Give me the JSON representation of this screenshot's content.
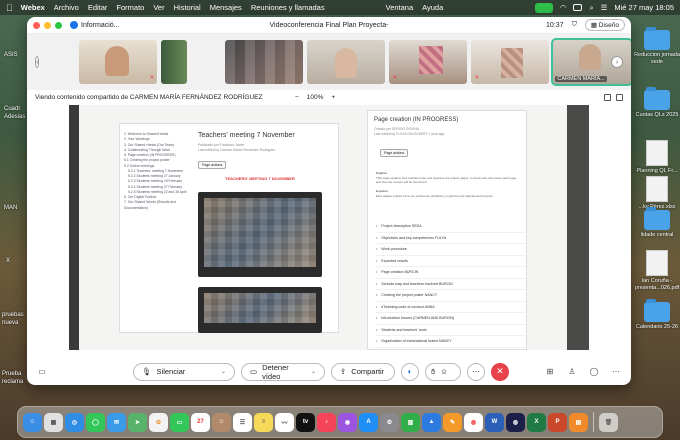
{
  "menubar": {
    "app": "Webex",
    "items": [
      "Archivo",
      "Editar",
      "Formato",
      "Ver",
      "Historial",
      "Mensajes",
      "Reuniones y llamadas"
    ],
    "extra": [
      "Ventana",
      "Ayuda"
    ],
    "datetime": "Mié 27 may 18:05"
  },
  "desktop": {
    "left_labels": [
      "ASIS",
      "Cuadr",
      "Adesias",
      "MAN",
      "X",
      "pruebas",
      "nueva",
      "Prueba",
      "reclama"
    ],
    "right_icons": [
      {
        "label": "Reduccion jornada sede",
        "kind": "folder"
      },
      {
        "label": "Cuotas QLs 2025",
        "kind": "folder"
      },
      {
        "label": "Planning QL Fr...",
        "kind": "doc"
      },
      {
        "label": "...ky Pérez.xlsx",
        "kind": "doc"
      },
      {
        "label": "lidade central",
        "kind": "folder"
      },
      {
        "label": "lan Coruña - presenta...026.pdf",
        "kind": "doc"
      },
      {
        "label": "Calendario 25-26",
        "kind": "folder"
      }
    ]
  },
  "window": {
    "info_label": "Informació...",
    "title": "Videoconferencia Final Plan Proyecta-",
    "time": "10:37",
    "layout_button": "Diseño"
  },
  "participants": [
    {
      "name": "",
      "muted": true
    },
    {
      "name": "",
      "muted": false
    },
    {
      "name": "",
      "muted": false
    },
    {
      "name": "",
      "muted": false
    },
    {
      "name": "",
      "muted": true
    },
    {
      "name": "",
      "muted": true
    },
    {
      "name": "CARMEN MARÍA...",
      "muted": false,
      "active": true
    }
  ],
  "viewbar": {
    "sharing_text": "Viendo contenido compartido de CARMEN MARÍA FERNÁNDEZ RODRÍGUEZ",
    "zoom_out": "−",
    "zoom_level": "100%",
    "zoom_in": "+"
  },
  "shared_doc_left": {
    "title": "Teachers' meeting 7 November",
    "meta1": "Publicado por Francisco Javier",
    "meta2": "Last edited by Carmen Maria Fernandez Rodriguez",
    "button": "Page actions",
    "red_heading": "TEACHERS' MEETING 7 NOVEMBER",
    "toc": [
      "1. Welcome to Shared Hands",
      "2. Your Workings",
      "3. Our Shared Hands (Our Team)",
      "4. Collaborating Through Work",
      "5. Page creation (IN PROGRESS)",
      "5.1 Creating the project poster",
      "5.2 Online meetings",
      "5.2.1 Teachers' meeting 7 November",
      "5.2.2 Students meeting 27 January",
      "5.2.3 Students meeting 18 February",
      "5.2.4 Students meeting 27 February",
      "5.2.5 Students meeting 22 and 30 April",
      "6. Our Digital Toolbox",
      "7. Our Shared Words (Results and Documentation)"
    ]
  },
  "shared_doc_right": {
    "title": "Page creation (IN PROGRESS)",
    "meta1": "Creado por SERGIO DOVINA",
    "meta2": "Last edited by FULYA GULIN BERT 1 year ago",
    "button": "Page actions",
    "english_label": "English",
    "english_text": "This page explains how teachers plan and organise the project pages. It shows who will create each page and how the content will be structured.",
    "spanish_label": "Español",
    "spanish_text": "Esta página explica cómo los profesores planifican y organizan las páginas del proyecto.",
    "items": [
      "Project description SEDA",
      "Objectives and key competences FULYA",
      "Work procedure",
      "Expected results",
      "Page creation BURCIN",
      "Schools map and teachers involved BURCIN",
      "Creating the project poster NANCY",
      "eTwinning code of conduct ANNA",
      "Introduction forums (CARMEN AND BURCIN)",
      "Students and teachers' tools",
      "Organization of transnational teams NANCY"
    ]
  },
  "controls": {
    "mute": "Silenciar",
    "stop_video": "Detener vídeo",
    "share": "Compartir"
  },
  "colors": {
    "accent": "#1a73e8",
    "leave": "#e8424a",
    "active_tile": "#3fbf9a",
    "heading_red": "#d33333"
  },
  "dock": {
    "apps": [
      "finder-icon",
      "launchpad-icon",
      "safari-icon",
      "messages-icon",
      "mail-icon",
      "maps-icon",
      "photos-icon",
      "facetime-icon",
      "calendar-icon",
      "contacts-icon",
      "reminders-icon",
      "notes-icon",
      "freeform-icon",
      "tv-icon",
      "music-icon",
      "podcasts-icon",
      "appstore-icon",
      "settings-icon",
      "numbers-icon",
      "keynote-icon",
      "pages-icon",
      "chrome-icon",
      "word-icon",
      "webex-icon",
      "excel-icon",
      "powerpoint-icon",
      "books-icon",
      "trash-icon"
    ],
    "calendar_day": "27"
  }
}
